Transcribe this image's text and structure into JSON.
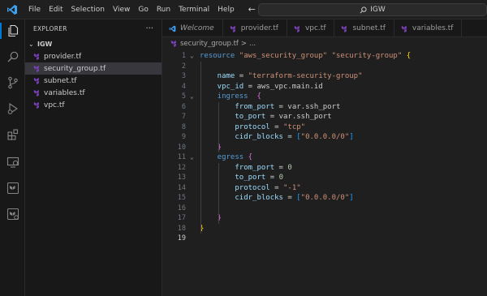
{
  "menu": [
    "File",
    "Edit",
    "Selection",
    "View",
    "Go",
    "Run",
    "Terminal",
    "Help"
  ],
  "search": {
    "label": "IGW"
  },
  "sidebar": {
    "title": "EXPLORER",
    "more": "···",
    "folder": "IGW",
    "files": [
      {
        "name": "provider.tf",
        "selected": false
      },
      {
        "name": "security_group.tf",
        "selected": true
      },
      {
        "name": "subnet.tf",
        "selected": false
      },
      {
        "name": "variables.tf",
        "selected": false
      },
      {
        "name": "vpc.tf",
        "selected": false
      }
    ]
  },
  "tabs": [
    {
      "label": "Welcome",
      "italic": true,
      "icon": "vscode-icon"
    },
    {
      "label": "provider.tf",
      "italic": false,
      "icon": "terraform-icon"
    },
    {
      "label": "vpc.tf",
      "italic": false,
      "icon": "terraform-icon"
    },
    {
      "label": "subnet.tf",
      "italic": false,
      "icon": "terraform-icon"
    },
    {
      "label": "variables.tf",
      "italic": false,
      "icon": "terraform-icon"
    }
  ],
  "breadcrumb": {
    "file": "security_group.tf",
    "sep": ">",
    "rest": "..."
  },
  "activity_icons": [
    "explorer-icon",
    "search-icon",
    "source-control-icon",
    "run-debug-icon",
    "extensions-icon",
    "remote-explorer-icon",
    "terraform-icon",
    "terraform-cloud-icon"
  ],
  "colors": {
    "accent": "#0078d4",
    "terraform": "#7b42bc",
    "keyword": "#569cd6",
    "string": "#ce9178",
    "attribute": "#9cdcfe"
  },
  "editor": {
    "lines": [
      {
        "n": "1",
        "fold": "v",
        "indent": 0,
        "tokens": [
          [
            "kw",
            "resource"
          ],
          [
            "plain",
            " "
          ],
          [
            "str",
            "\"aws_security_group\""
          ],
          [
            "plain",
            " "
          ],
          [
            "str",
            "\"security-group\""
          ],
          [
            "plain",
            " "
          ],
          [
            "brace",
            "{"
          ]
        ]
      },
      {
        "n": "2",
        "fold": "",
        "indent": 0,
        "tokens": []
      },
      {
        "n": "3",
        "fold": "",
        "indent": 1,
        "tokens": [
          [
            "attr",
            "name"
          ],
          [
            "plain",
            " = "
          ],
          [
            "str",
            "\"terraform-security-group\""
          ]
        ]
      },
      {
        "n": "4",
        "fold": "",
        "indent": 1,
        "tokens": [
          [
            "attr",
            "vpc_id"
          ],
          [
            "plain",
            " = "
          ],
          [
            "ident",
            "aws_vpc.main.id"
          ]
        ]
      },
      {
        "n": "5",
        "fold": "v",
        "indent": 1,
        "tokens": [
          [
            "kw",
            "ingress"
          ],
          [
            "plain",
            "  "
          ],
          [
            "brace2",
            "{"
          ]
        ]
      },
      {
        "n": "6",
        "fold": "",
        "indent": 2,
        "tokens": [
          [
            "attr",
            "from_port"
          ],
          [
            "plain",
            " = "
          ],
          [
            "ident",
            "var.ssh_port"
          ]
        ]
      },
      {
        "n": "7",
        "fold": "",
        "indent": 2,
        "tokens": [
          [
            "attr",
            "to_port"
          ],
          [
            "plain",
            " = "
          ],
          [
            "ident",
            "var.ssh_port"
          ]
        ]
      },
      {
        "n": "8",
        "fold": "",
        "indent": 2,
        "tokens": [
          [
            "attr",
            "protocol"
          ],
          [
            "plain",
            " = "
          ],
          [
            "str",
            "\"tcp\""
          ]
        ]
      },
      {
        "n": "9",
        "fold": "",
        "indent": 2,
        "tokens": [
          [
            "attr",
            "cidr_blocks"
          ],
          [
            "plain",
            " = "
          ],
          [
            "brack",
            "["
          ],
          [
            "str",
            "\"0.0.0.0/0\""
          ],
          [
            "brack",
            "]"
          ]
        ]
      },
      {
        "n": "10",
        "fold": "",
        "indent": 1,
        "tokens": [
          [
            "brace2",
            "}"
          ]
        ]
      },
      {
        "n": "11",
        "fold": "v",
        "indent": 1,
        "tokens": [
          [
            "kw",
            "egress"
          ],
          [
            "plain",
            " "
          ],
          [
            "brace2",
            "{"
          ]
        ]
      },
      {
        "n": "12",
        "fold": "",
        "indent": 2,
        "tokens": [
          [
            "attr",
            "from_port"
          ],
          [
            "plain",
            " = "
          ],
          [
            "num",
            "0"
          ]
        ]
      },
      {
        "n": "13",
        "fold": "",
        "indent": 2,
        "tokens": [
          [
            "attr",
            "to_port"
          ],
          [
            "plain",
            " = "
          ],
          [
            "num",
            "0"
          ]
        ]
      },
      {
        "n": "14",
        "fold": "",
        "indent": 2,
        "tokens": [
          [
            "attr",
            "protocol"
          ],
          [
            "plain",
            " = "
          ],
          [
            "str",
            "\"-1\""
          ]
        ]
      },
      {
        "n": "15",
        "fold": "",
        "indent": 2,
        "tokens": [
          [
            "attr",
            "cidr_blocks"
          ],
          [
            "plain",
            " = "
          ],
          [
            "brack",
            "["
          ],
          [
            "str",
            "\"0.0.0.0/0\""
          ],
          [
            "brack",
            "]"
          ]
        ]
      },
      {
        "n": "16",
        "fold": "",
        "indent": 1,
        "tokens": []
      },
      {
        "n": "17",
        "fold": "",
        "indent": 1,
        "tokens": [
          [
            "brace2",
            "}"
          ]
        ]
      },
      {
        "n": "18",
        "fold": "",
        "indent": 0,
        "tokens": [
          [
            "brace",
            "}"
          ]
        ]
      },
      {
        "n": "19",
        "fold": "",
        "indent": 0,
        "tokens": [],
        "current": true
      }
    ]
  }
}
